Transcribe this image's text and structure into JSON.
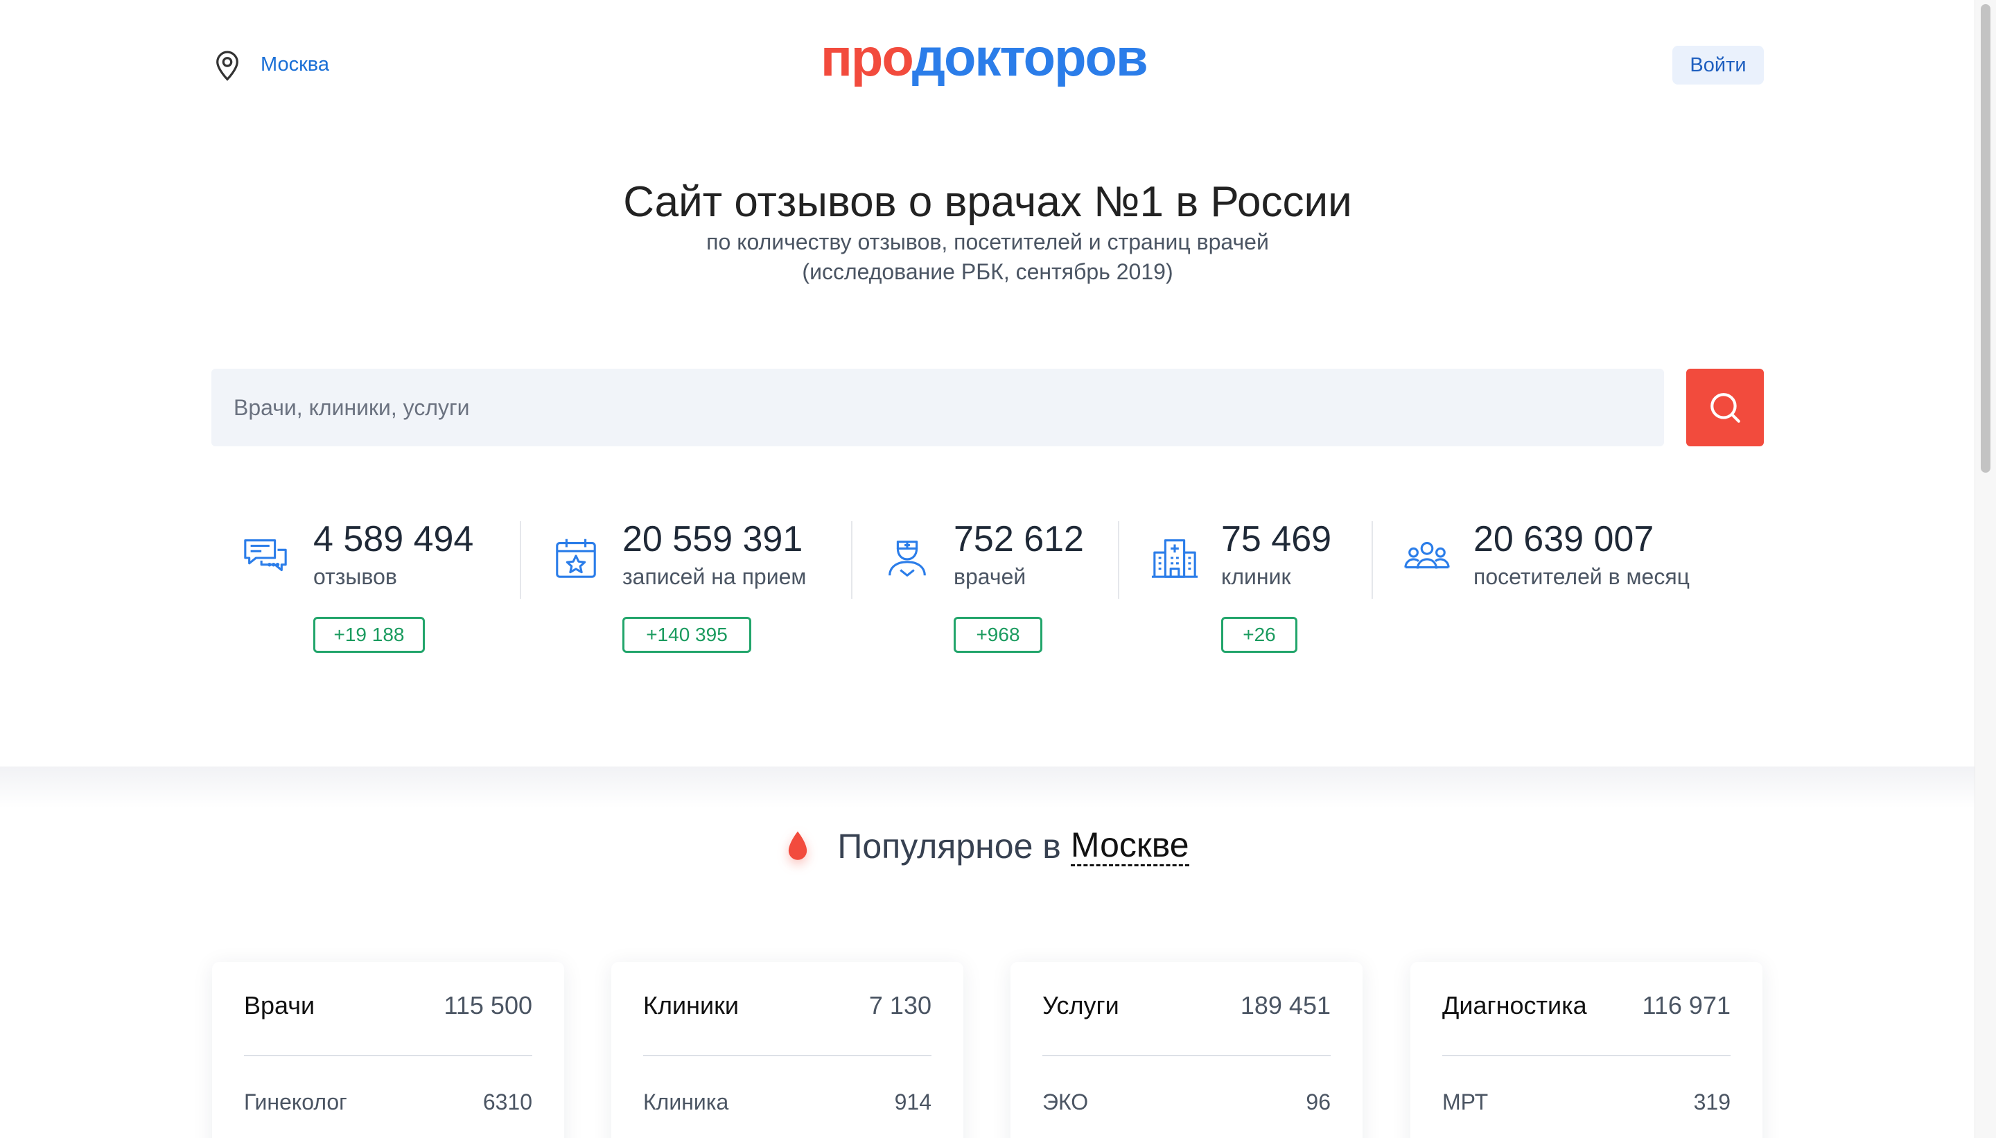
{
  "header": {
    "city": "Москва",
    "logo_part1": "про",
    "logo_part2": "докторов",
    "login_label": "Войти"
  },
  "hero": {
    "title": "Сайт отзывов о врачах №1 в России",
    "subtitle_line1": "по количеству отзывов, посетителей и страниц врачей",
    "subtitle_line2": "(исследование РБК, сентябрь 2019)"
  },
  "search": {
    "placeholder": "Врачи, клиники, услуги"
  },
  "stats": [
    {
      "icon": "reviews-chat-icon",
      "value": "4 589 494",
      "label": "отзывов",
      "delta": "+19 188"
    },
    {
      "icon": "calendar-star-icon",
      "value": "20 559 391",
      "label": "записей на прием",
      "delta": "+140 395"
    },
    {
      "icon": "doctor-icon",
      "value": "752 612",
      "label": "врачей",
      "delta": "+968"
    },
    {
      "icon": "hospital-icon",
      "value": "75 469",
      "label": "клиник",
      "delta": "+26"
    },
    {
      "icon": "visitors-group-icon",
      "value": "20 639 007",
      "label": "посетителей в месяц",
      "delta": ""
    }
  ],
  "popular": {
    "prefix": "Популярное в",
    "city": "Москве"
  },
  "cards": [
    {
      "title": "Врачи",
      "count": "115 500",
      "row_label": "Гинеколог",
      "row_value": "6310"
    },
    {
      "title": "Клиники",
      "count": "7 130",
      "row_label": "Клиника",
      "row_value": "914"
    },
    {
      "title": "Услуги",
      "count": "189 451",
      "row_label": "ЭКО",
      "row_value": "96"
    },
    {
      "title": "Диагностика",
      "count": "116 971",
      "row_label": "МРТ",
      "row_value": "319"
    }
  ],
  "colors": {
    "brand_red": "#f24b3d",
    "brand_blue": "#2b7de9",
    "link_blue": "#1a6fd6",
    "delta_green": "#1b9b5f"
  }
}
